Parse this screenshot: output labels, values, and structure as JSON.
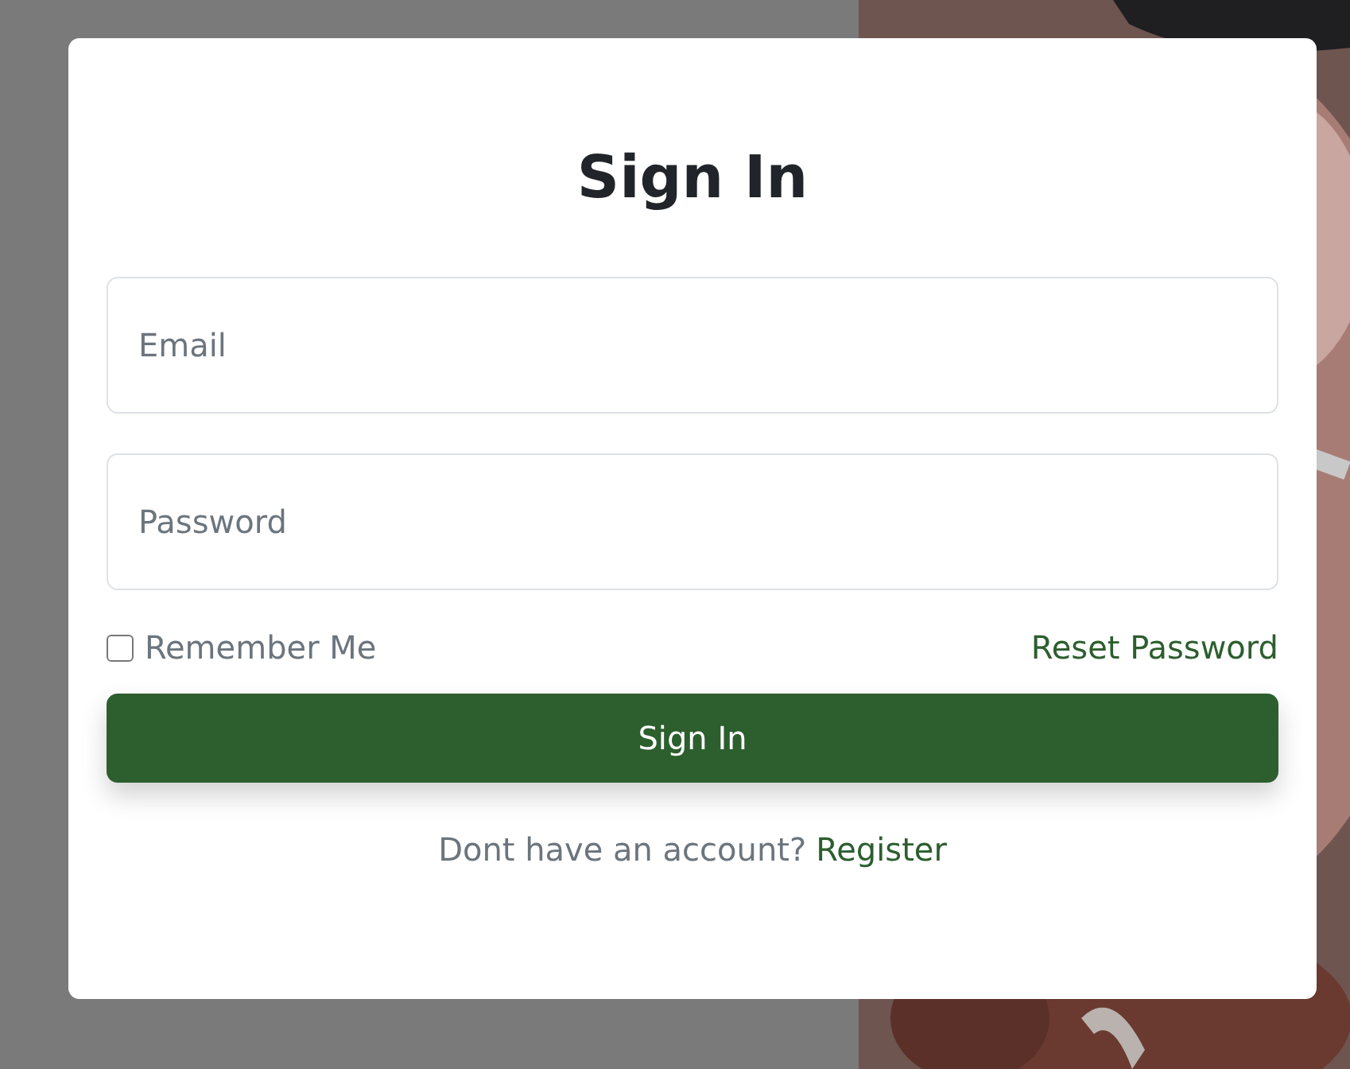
{
  "title": "Sign In",
  "fields": [
    {
      "placeholder": "Email"
    },
    {
      "placeholder": "Password"
    }
  ],
  "remember": {
    "label": "Remember Me",
    "checked": false
  },
  "reset_link": "Reset Password",
  "submit": "Sign In",
  "footer": {
    "text": "Dont have an account?",
    "link": "Register"
  }
}
